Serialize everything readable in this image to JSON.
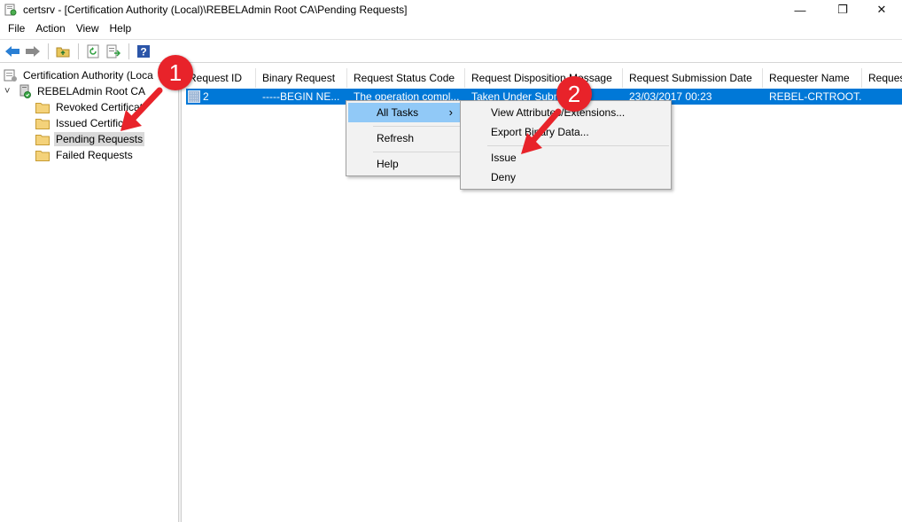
{
  "window": {
    "title": "certsrv - [Certification Authority (Local)\\REBELAdmin Root CA\\Pending Requests]",
    "minimize_glyph": "—",
    "maximize_glyph": "❐",
    "close_glyph": "✕"
  },
  "menu": [
    "File",
    "Action",
    "View",
    "Help"
  ],
  "toolbar": {
    "icons": [
      "back-arrow-icon",
      "forward-arrow-icon",
      "up-folder-icon",
      "refresh-icon",
      "export-list-icon",
      "help-icon"
    ]
  },
  "tree": {
    "root_label": "Certification Authority (Loca",
    "ca_label": "REBELAdmin Root CA",
    "ca_expander": "˅",
    "children": [
      {
        "label": "Revoked Certificat",
        "selected": false
      },
      {
        "label": "Issued Certific",
        "selected": false
      },
      {
        "label": "Pending Requests",
        "selected": true
      },
      {
        "label": "Failed Requests",
        "selected": false
      }
    ]
  },
  "list": {
    "columns": [
      "Request ID",
      "Binary Request",
      "Request Status Code",
      "Request Disposition Message",
      "Request Submission Date",
      "Requester Name",
      "Request"
    ],
    "rows": [
      {
        "request_id": "2",
        "binary_request": "-----BEGIN NE...",
        "status_code": "The operation compl...",
        "disposition": "Taken Under Subm",
        "submission_date": "23/03/2017 00:23",
        "requester": "REBEL-CRTROOT..."
      }
    ]
  },
  "context_menu": {
    "items": [
      "All Tasks",
      "Refresh",
      "Help"
    ],
    "submenu_arrow": "›",
    "submenu": [
      "View Attributes/Extensions...",
      "Export Binary Data...",
      "Issue",
      "Deny"
    ]
  },
  "annotations": {
    "badge1": "1",
    "badge2": "2"
  },
  "colors": {
    "selection_blue": "#0078d7",
    "menu_highlight": "#91c9f7",
    "callout_red": "#e8232a"
  }
}
